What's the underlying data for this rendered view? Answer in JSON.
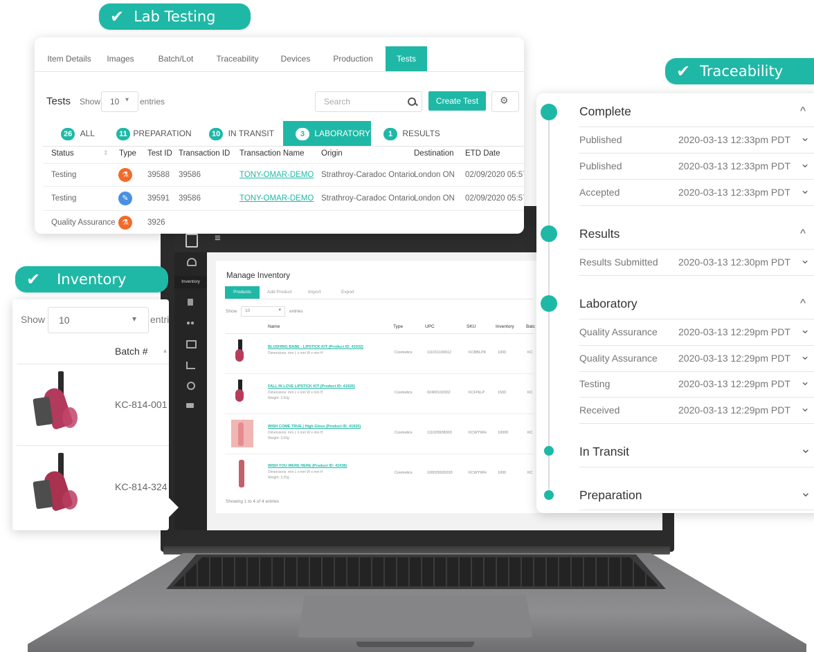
{
  "pills": {
    "lab_testing": "Lab Testing",
    "traceability": "Traceability",
    "inventory": "Inventory",
    "check": "✔"
  },
  "lab": {
    "tabs": [
      "Item Details",
      "Images",
      "Batch/Lot",
      "Traceability",
      "Devices",
      "Production",
      "Tests"
    ],
    "active_tab": "Tests",
    "heading": "Tests",
    "show_label": "Show",
    "entries_value": "10",
    "entries_label": "entries",
    "search_placeholder": "Search",
    "create_label": "Create Test",
    "filters": [
      {
        "count": "26",
        "label": "ALL"
      },
      {
        "count": "11",
        "label": "PREPARATION"
      },
      {
        "count": "10",
        "label": "IN TRANSIT"
      },
      {
        "count": "3",
        "label": "LABORATORY"
      },
      {
        "count": "1",
        "label": "RESULTS"
      }
    ],
    "columns": [
      "Status",
      "Type",
      "Test ID",
      "Transaction ID",
      "Transaction Name",
      "Origin",
      "Destination",
      "ETD Date"
    ],
    "rows": [
      {
        "status": "Testing",
        "test_id": "39588",
        "transaction_id": "39586",
        "transaction_name": "TONY-OMAR-DEMO",
        "origin": "Strathroy-Caradoc Ontario",
        "destination": "London ON",
        "etd": "02/09/2020 05:57",
        "type_color": "#f26a2a"
      },
      {
        "status": "Testing",
        "test_id": "39591",
        "transaction_id": "39586",
        "transaction_name": "TONY-OMAR-DEMO",
        "origin": "Strathroy-Caradoc Ontario",
        "destination": "London ON",
        "etd": "02/09/2020 05:57",
        "type_color": "#4a90e2"
      },
      {
        "status": "Quality Assurance",
        "test_id": "3926",
        "transaction_id": "",
        "transaction_name": "",
        "origin": "",
        "destination": "",
        "etd": "",
        "type_color": "#f26a2a"
      }
    ]
  },
  "trace": {
    "sections": [
      {
        "title": "Complete",
        "rows": [
          {
            "label": "Published",
            "time": "2020-03-13 12:33pm PDT"
          },
          {
            "label": "Published",
            "time": "2020-03-13 12:33pm PDT"
          },
          {
            "label": "Accepted",
            "time": "2020-03-13 12:33pm PDT"
          }
        ]
      },
      {
        "title": "Results",
        "rows": [
          {
            "label": "Results Submitted",
            "time": "2020-03-13 12:30pm PDT"
          }
        ]
      },
      {
        "title": "Laboratory",
        "rows": [
          {
            "label": "Quality Assurance",
            "time": "2020-03-13 12:29pm PDT"
          },
          {
            "label": "Quality Assurance",
            "time": "2020-03-13 12:29pm PDT"
          },
          {
            "label": "Testing",
            "time": "2020-03-13 12:29pm PDT"
          },
          {
            "label": "Received",
            "time": "2020-03-13 12:29pm PDT"
          }
        ]
      },
      {
        "title": "In Transit",
        "rows": []
      },
      {
        "title": "Preparation",
        "rows": []
      }
    ],
    "up": "^",
    "down": "⌄"
  },
  "inventory_panel": {
    "show_label": "Show",
    "show_value": "10",
    "entries_partial": "entri",
    "batch_header": "Batch #",
    "items": [
      "KC-814-001",
      "KC-814-324"
    ]
  },
  "laptop": {
    "menu_icon": "≡",
    "sidebar_active": "Inventory",
    "title": "Manage Inventory",
    "tabs": [
      "Products",
      "Add Product",
      "Import",
      "Export"
    ],
    "show_label": "Show",
    "show_value": "10",
    "entries_label": "entries",
    "columns": [
      "Name",
      "Type",
      "UPC",
      "SKU",
      "Inventory",
      "Batc"
    ],
    "products": [
      {
        "name": "BLUSHING BABE - LIPSTICK KIT (Product ID: 41932)",
        "dims": "Dimensions: mm L x mm W x mm H",
        "weight": "",
        "type": "Cosmetics",
        "upc": "111011100012",
        "sku": "KCBBLPK",
        "inventory": "1000",
        "batch": "KC"
      },
      {
        "name": "FALL IN LOVE LIPSTICK KIT (Product ID: 41926)",
        "dims": "Dimensions: mm L x mm W x mm H",
        "weight": "Weight: 3.50g",
        "type": "Cosmetics",
        "upc": "02400102002",
        "sku": "KCFINLP",
        "inventory": "1500",
        "batch": "KC"
      },
      {
        "name": "WISH COME TRUE | High Gloss (Product ID: 41920)",
        "dims": "Dimensions: mm L x mm W x mm H",
        "weight": "Weight: 3.00g",
        "type": "Cosmetics",
        "upc": "111029938003",
        "sku": "KCWYWH",
        "inventory": "10000",
        "batch": "KC"
      },
      {
        "name": "WISH YOU WERE HERE (Product ID: 41938)",
        "dims": "Dimensions: mm L x mm W x mm H",
        "weight": "Weight: 3.25g",
        "type": "Cosmetics",
        "upc": "100029930293",
        "sku": "KCWYWH",
        "inventory": "1000",
        "batch": "KC"
      }
    ],
    "footer": "Showing 1 to 4 of 4 entries"
  }
}
